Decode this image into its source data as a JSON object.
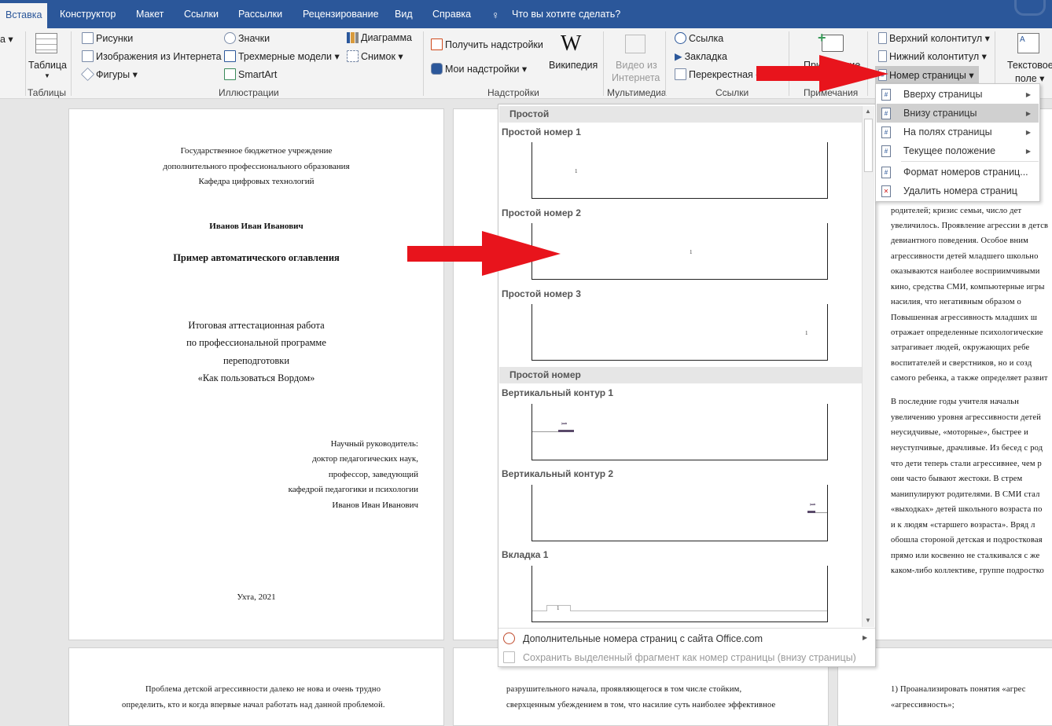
{
  "tabs": [
    "Вставка",
    "Конструктор",
    "Макет",
    "Ссылки",
    "Рассылки",
    "Рецензирование",
    "Вид",
    "Справка"
  ],
  "tell_me": "Что вы хотите сделать?",
  "ribbon": {
    "cut_label": "а ▾",
    "tables": {
      "table": "Таблица",
      "group": "Таблицы"
    },
    "illustrations": {
      "pictures": "Рисунки",
      "online_pictures": "Изображения из Интернета",
      "shapes": "Фигуры ▾",
      "icons": "Значки",
      "models3d": "Трехмерные модели ▾",
      "smartart": "SmartArt",
      "chart": "Диаграмма",
      "screenshot": "Снимок ▾",
      "group": "Иллюстрации"
    },
    "addins": {
      "get": "Получить надстройки",
      "my": "Мои надстройки ▾",
      "wikipedia": "Википедия",
      "group": "Надстройки"
    },
    "media": {
      "video1": "Видео из",
      "video2": "Интернета",
      "group": "Мультимедиа"
    },
    "links": {
      "link": "Ссылка",
      "bookmark": "Закладка",
      "crossref": "Перекрестная ссылка",
      "group": "Ссылки"
    },
    "comments": {
      "comment": "Примечание",
      "group": "Примечания"
    },
    "header_footer": {
      "header": "Верхний колонтитул ▾",
      "footer": "Нижний колонтитул ▾",
      "page_number": "Номер страницы ▾"
    },
    "text": {
      "textbox1": "Текстовое",
      "textbox2": "поле ▾"
    }
  },
  "page1": {
    "org": [
      "Государственное бюджетное учреждение",
      "дополнительного профессионального образования",
      "Кафедра цифровых технологий"
    ],
    "author": "Иванов Иван Иванович",
    "title": "Пример автоматического оглавления",
    "work": [
      "Итоговая аттестационная работа",
      "по профессиональной программе",
      "переподготовки",
      "«Как пользоваться Вордом»"
    ],
    "supervisor": [
      "Научный руководитель:",
      "доктор педагогических наук,",
      "профессор, заведующий",
      "кафедрой педагогики и психологии",
      "Иванов Иван Иванович"
    ],
    "city": "Ухта, 2021"
  },
  "page3_lines": [
    "ЕН",
    "авн",
    "ми.",
    "и с",
    "родителей;  кризис  семьи,  число  дет",
    "увеличилось. Проявление агрессии в детсв",
    "девиантного   поведения.   Особое   вним",
    "агрессивности  детей  младшего  школьно",
    "оказываются  наиболее  восприимчивыми",
    "кино, средства СМИ, компьютерные игры",
    "насилия,   что   негативным   образом   о",
    "Повышенная  агрессивность  младших  ш",
    "отражает определенные психологические",
    "затрагивает   людей,   окружающих   ребе",
    "воспитателей  и  сверстников,  но  и  созд",
    "самого ребенка, а также определяет развит",
    "        В последние годы учителя начальн",
    "увеличению уровня агрессивности детей",
    "неусидчивые,  «моторные»,  быстрее  и",
    "неуступчивые, драчливые. Из бесед с род",
    "что дети теперь стали агрессивнее, чем р",
    "они  часто  бывают  жестоки.  В  стрем",
    "манипулируют  родителями.  В  СМИ  стал",
    "«выходках» детей школьного возраста по",
    "и  к  людям  «старшего  возраста».  Вряд  л",
    "обошла стороной детская и подростковая",
    "прямо или косвенно не сталкивался с же",
    "каком-либо коллективе, группе подростко"
  ],
  "bottom_pages": {
    "p1": [
      "Проблема детской агрессивности далеко не нова и очень трудно",
      "определить, кто и когда впервые начал работать над данной проблемой."
    ],
    "p2": [
      "разрушительного  начала,  проявляющегося  в  том  числе  стойким,",
      "сверхценным убеждением в том, что насилие суть наиболее эффективное"
    ],
    "p3": [
      "1)  Проанализировать  понятия  «агрес",
      "«агрессивность»;"
    ]
  },
  "gallery": {
    "section1": "Простой",
    "items1": [
      "Простой номер 1",
      "Простой номер 2",
      "Простой номер 3"
    ],
    "section2": "Простой номер",
    "items2": [
      "Вертикальный контур 1",
      "Вертикальный контур 2",
      "Вкладка 1"
    ],
    "num": "1",
    "more": "Дополнительные номера страниц с сайта Office.com",
    "save": "Сохранить выделенный фрагмент как номер страницы (внизу страницы)"
  },
  "submenu": [
    "Вверху страницы",
    "Внизу страницы",
    "На полях страницы",
    "Текущее положение",
    "Формат номеров страниц...",
    "Удалить номера страниц"
  ],
  "colors": {
    "tabbar": "#2b579a",
    "arrow": "#e8141c",
    "highlight": "#d0d0d0"
  }
}
